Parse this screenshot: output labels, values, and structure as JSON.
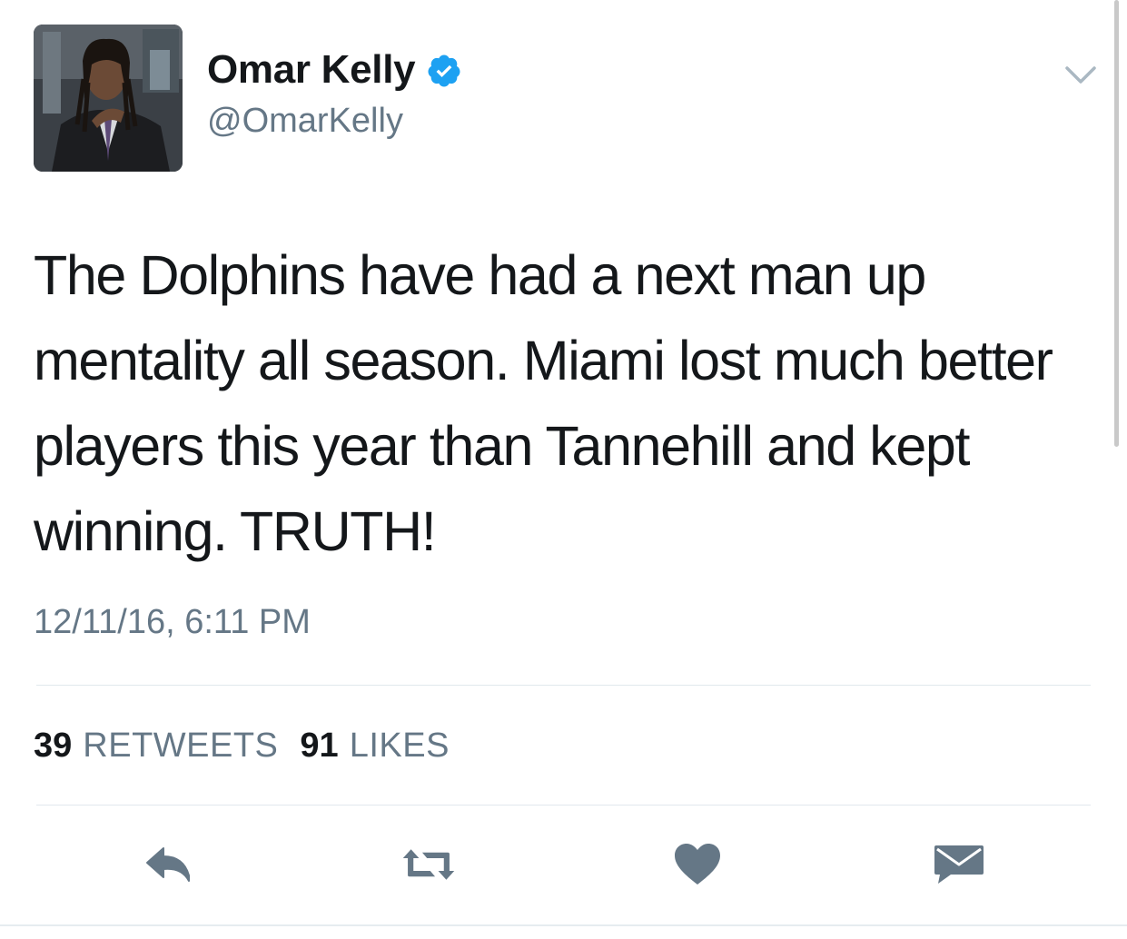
{
  "user": {
    "display_name": "Omar Kelly",
    "handle": "@OmarKelly",
    "verified": true
  },
  "tweet": {
    "text": "The Dolphins have had a next man up mentality all season. Miami lost much better players this year than Tannehill and kept winning. TRUTH!",
    "timestamp": "12/11/16, 6:11 PM"
  },
  "stats": {
    "retweets_count": "39",
    "retweets_label": "RETWEETS",
    "likes_count": "91",
    "likes_label": "LIKES"
  },
  "actions": {
    "reply_icon": "reply-icon",
    "retweet_icon": "retweet-icon",
    "like_icon": "heart-icon",
    "dm_icon": "envelope-icon"
  },
  "colors": {
    "verified_blue": "#1da1f2",
    "text_primary": "#14171a",
    "text_secondary": "#657786",
    "icon_gray": "#657786"
  }
}
